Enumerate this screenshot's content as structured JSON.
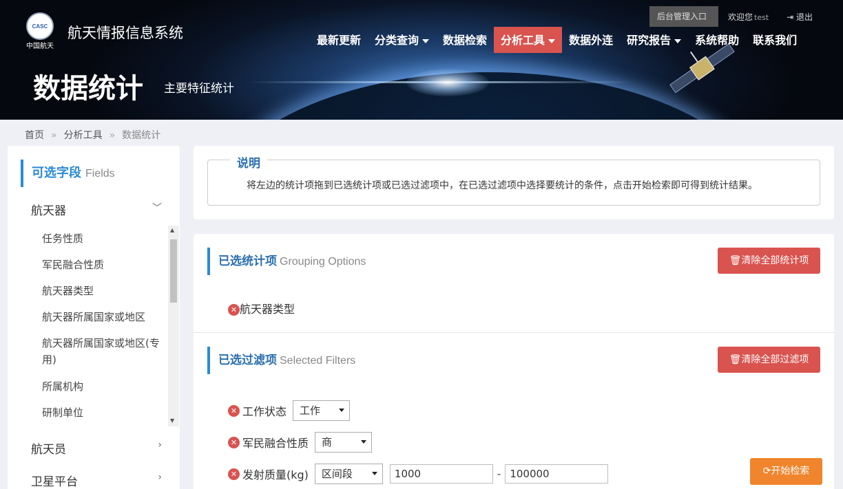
{
  "header": {
    "logo_text": "中国航天",
    "logo_mark": "CASC",
    "site_title": "航天情报信息系统",
    "admin_label": "后台管理入口",
    "welcome": "欢迎您",
    "username": "test",
    "logout": "退出",
    "nav": [
      {
        "label": "最新更新",
        "dropdown": false,
        "active": false
      },
      {
        "label": "分类查询",
        "dropdown": true,
        "active": false
      },
      {
        "label": "数据检索",
        "dropdown": false,
        "active": false
      },
      {
        "label": "分析工具",
        "dropdown": true,
        "active": true
      },
      {
        "label": "数据外连",
        "dropdown": false,
        "active": false
      },
      {
        "label": "研究报告",
        "dropdown": true,
        "active": false
      },
      {
        "label": "系统帮助",
        "dropdown": false,
        "active": false
      },
      {
        "label": "联系我们",
        "dropdown": false,
        "active": false
      }
    ],
    "page_title": "数据统计",
    "page_subtitle": "主要特征统计",
    "active_color": "#d9534f"
  },
  "breadcrumb": [
    "首页",
    "分析工具",
    "数据统计"
  ],
  "sidebar": {
    "title_cn": "可选字段",
    "title_en": "Fields",
    "groups": [
      {
        "label": "航天器",
        "expanded": true
      },
      {
        "label": "航天员",
        "expanded": false
      },
      {
        "label": "卫星平台",
        "expanded": false
      }
    ],
    "items": [
      "任务性质",
      "军民融合性质",
      "航天器类型",
      "航天器所属国家或地区",
      "航天器所属国家或地区(专用)",
      "所属机构",
      "研制单位"
    ]
  },
  "note": {
    "legend": "说明",
    "text": "将左边的统计项拖到已选统计项或已选过滤项中，在已选过滤项中选择要统计的条件，点击开始检索即可得到统计结果。"
  },
  "grouping": {
    "title_cn": "已选统计项",
    "title_en": "Grouping Options",
    "clear_label": "清除全部统计项",
    "items": [
      "航天器类型"
    ]
  },
  "filters": {
    "title_cn": "已选过滤项",
    "title_en": "Selected Filters",
    "clear_label": "清除全部过滤项",
    "rows": [
      {
        "label": "工作状态",
        "selected": "工作"
      },
      {
        "label": "军民融合性质",
        "selected": "商"
      },
      {
        "label": "发射质量(kg)",
        "selected": "区间段",
        "min": "1000",
        "max": "100000"
      }
    ]
  },
  "search_label": "开始检索",
  "colors": {
    "accent": "#2a8bd6",
    "danger": "#d9534f",
    "warning": "#f0852d"
  }
}
